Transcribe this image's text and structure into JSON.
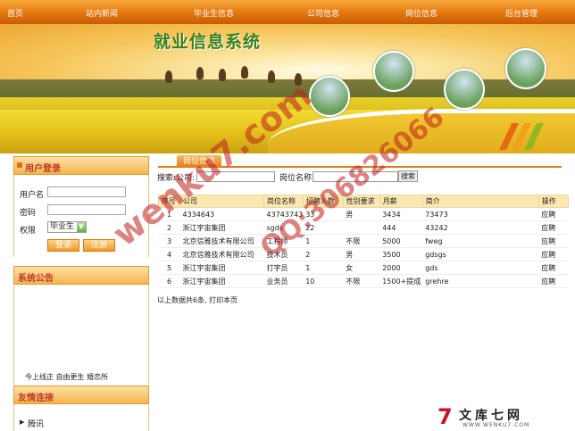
{
  "nav": [
    "首页",
    "站内新闻",
    "毕业生信息",
    "公司信息",
    "岗位信息",
    "后台管理"
  ],
  "banner_title": "就业信息系统",
  "login": {
    "heading": "用户登录",
    "username_label": "用户名",
    "password_label": "密码",
    "role_label": "权限",
    "role_value": "毕业生",
    "login_btn": "登录",
    "register_btn": "注册"
  },
  "notice": {
    "heading": "系统公告",
    "ticker": "今上线正 自由更生 婚恋所"
  },
  "links": {
    "heading": "友情连接",
    "items": [
      "腾讯"
    ]
  },
  "tab_label": "岗位信息",
  "search": {
    "label": "搜索:公司:",
    "job_label": "岗位名称",
    "button": "搜索"
  },
  "table": {
    "headers": [
      "序号",
      "公司",
      "岗位名称",
      "招聘人数",
      "性别要求",
      "月薪",
      "简介",
      "操作"
    ],
    "rows": [
      [
        "1",
        "4334643",
        "43743743",
        "33",
        "男",
        "3434",
        "73473",
        "应聘"
      ],
      [
        "2",
        "浙江宇宙集团",
        "sgds",
        "22",
        "",
        "444",
        "43242",
        "应聘"
      ],
      [
        "3",
        "北京信雅技术有限公司",
        "工程师",
        "1",
        "不限",
        "5000",
        "fweg",
        "应聘"
      ],
      [
        "4",
        "北京信雅技术有限公司",
        "技术员",
        "2",
        "男",
        "3500",
        "gdsgs",
        "应聘"
      ],
      [
        "5",
        "浙江宇宙集团",
        "打字员",
        "1",
        "女",
        "2000",
        "gds",
        "应聘"
      ],
      [
        "6",
        "浙江宇宙集团",
        "业务员",
        "10",
        "不限",
        "1500+提成",
        "grehre",
        "应聘"
      ]
    ]
  },
  "footnote": "以上数据共6条, 打印本页",
  "watermark": {
    "site": "wenku7.com",
    "qq": "QQ:306826066"
  },
  "corner_logo": {
    "cn": "文库七网",
    "en": "WWW.WENKU7.COM"
  },
  "colors": {
    "accent": "#e47b14",
    "title_green": "#3a7f1a",
    "watermark_red": "#c02020"
  }
}
